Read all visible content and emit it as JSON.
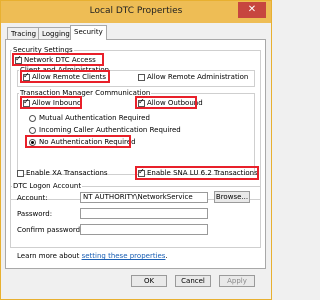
{
  "window": {
    "title": "Local DTC Properties",
    "close_glyph": "✕"
  },
  "tabs": [
    {
      "label": "Tracing"
    },
    {
      "label": "Logging"
    },
    {
      "label": "Security"
    }
  ],
  "security_settings": {
    "label": "Security Settings",
    "network_dtc_access": {
      "label": "Network DTC Access",
      "checked": true
    },
    "client_admin": {
      "label": "Client and Administration",
      "allow_remote_clients": {
        "label": "Allow Remote Clients",
        "checked": true
      },
      "allow_remote_admin": {
        "label": "Allow Remote Administration",
        "checked": false
      }
    },
    "tm_comm": {
      "label": "Transaction Manager Communication",
      "allow_inbound": {
        "label": "Allow Inbound",
        "checked": true
      },
      "allow_outbound": {
        "label": "Allow Outbound",
        "checked": true
      },
      "mutual_auth": {
        "label": "Mutual Authentication Required",
        "selected": false
      },
      "incoming_auth": {
        "label": "Incoming Caller Authentication Required",
        "selected": false
      },
      "no_auth": {
        "label": "No Authentication Required",
        "selected": true
      }
    },
    "enable_xa": {
      "label": "Enable XA Transactions",
      "checked": false
    },
    "enable_sna": {
      "label": "Enable SNA LU 6.2 Transactions",
      "checked": true
    }
  },
  "logon_account": {
    "label": "DTC Logon Account",
    "account_label": "Account:",
    "account_value": "NT AUTHORITY\\NetworkService",
    "browse_label": "Browse...",
    "password_label": "Password:",
    "confirm_label": "Confirm password:"
  },
  "learn_more": {
    "prefix": "Learn more about ",
    "link": "setting these properties",
    "suffix": "."
  },
  "footer": {
    "ok": "OK",
    "cancel": "Cancel",
    "apply": "Apply"
  }
}
